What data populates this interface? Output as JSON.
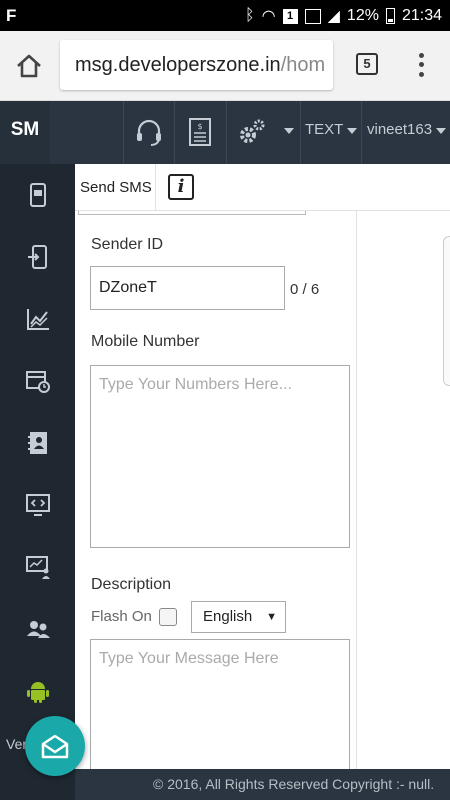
{
  "statusbar": {
    "battery": "12%",
    "time": "21:34",
    "notification_count": "1"
  },
  "browser": {
    "url_main": "msg.developerszone.in",
    "url_rest": "/hom",
    "tab_count": "5"
  },
  "topnav": {
    "brand": "SM",
    "mode": "TEXT",
    "user": "vineet163"
  },
  "tabs": {
    "send_sms": "Send SMS",
    "info": "i"
  },
  "form": {
    "sender_id_label": "Sender ID",
    "sender_id_value": "DZoneT",
    "sender_counter": "0 / 6",
    "mobile_label": "Mobile Number",
    "mobile_placeholder": "Type Your Numbers Here...",
    "description_label": "Description",
    "flash_label": "Flash On",
    "language": "English",
    "message_placeholder": "Type Your Message Here"
  },
  "sidebar": {
    "partial_label": "Ver"
  },
  "footer": {
    "copyright": "© 2016, All Rights Reserved Copyright :- null."
  },
  "colors": {
    "nav_bg": "#2a3541",
    "sidebar_bg": "#1f2831",
    "fab": "#1aa8a8",
    "android": "#97c024"
  }
}
